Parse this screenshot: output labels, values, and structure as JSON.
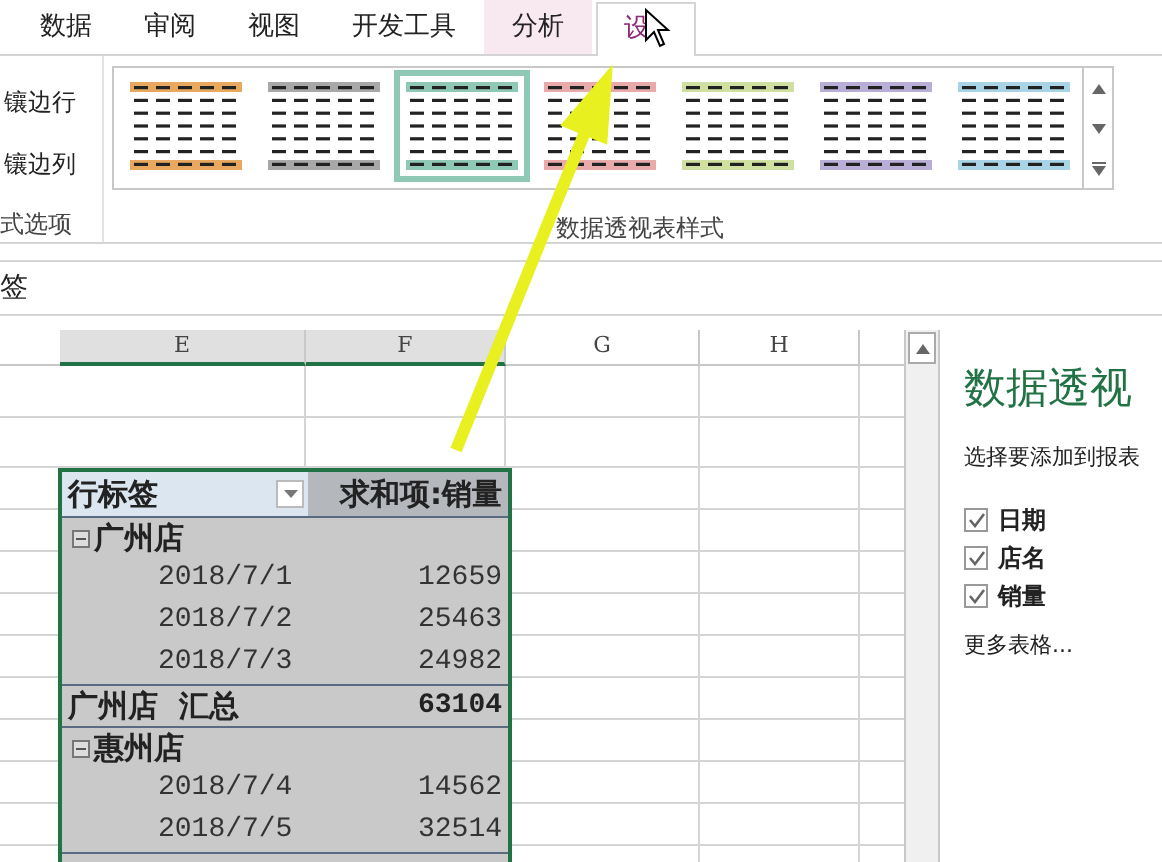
{
  "tabs": [
    {
      "label": "数据",
      "selected": false,
      "kind": "plain"
    },
    {
      "label": "审阅",
      "selected": false,
      "kind": "plain"
    },
    {
      "label": "视图",
      "selected": false,
      "kind": "plain"
    },
    {
      "label": "开发工具",
      "selected": false,
      "kind": "plain"
    },
    {
      "label": "分析",
      "selected": false,
      "kind": "context"
    },
    {
      "label": "设",
      "selected": true,
      "kind": "context"
    }
  ],
  "style_options": {
    "items": [
      {
        "label": "镶边行"
      },
      {
        "label": "镶边列"
      }
    ],
    "group_label": "式选项"
  },
  "styles_gallery": {
    "group_label": "数据透视表样式",
    "styles": [
      {
        "color": "#e8a860",
        "selected": false
      },
      {
        "color": "#a8a8a8",
        "selected": false
      },
      {
        "color": "#8fc8b4",
        "selected": true
      },
      {
        "color": "#e8aaaa",
        "selected": false
      },
      {
        "color": "#cfe0a0",
        "selected": false
      },
      {
        "color": "#b8aed6",
        "selected": false
      },
      {
        "color": "#a8d4e6",
        "selected": false
      }
    ]
  },
  "formula_bar": {
    "value": "签"
  },
  "columns": [
    "E",
    "F",
    "G",
    "H"
  ],
  "pivot": {
    "header": {
      "label": "行标签",
      "value": "求和项:销量"
    },
    "rows": [
      {
        "kind": "group",
        "label": "广州店",
        "expanded": true
      },
      {
        "kind": "item",
        "label": "2018/7/1",
        "value": "12659"
      },
      {
        "kind": "item",
        "label": "2018/7/2",
        "value": "25463"
      },
      {
        "kind": "item",
        "label": "2018/7/3",
        "value": "24982"
      },
      {
        "kind": "subtotal",
        "label": "广州店  汇总",
        "value": "63104"
      },
      {
        "kind": "group",
        "label": "惠州店",
        "expanded": true
      },
      {
        "kind": "item",
        "label": "2018/7/4",
        "value": "14562"
      },
      {
        "kind": "item",
        "label": "2018/7/5",
        "value": "32514"
      }
    ]
  },
  "field_pane": {
    "title": "数据透视",
    "subtitle": "选择要添加到报表",
    "fields": [
      {
        "label": "日期",
        "checked": true
      },
      {
        "label": "店名",
        "checked": true
      },
      {
        "label": "销量",
        "checked": true
      }
    ],
    "more_link": "更多表格..."
  }
}
